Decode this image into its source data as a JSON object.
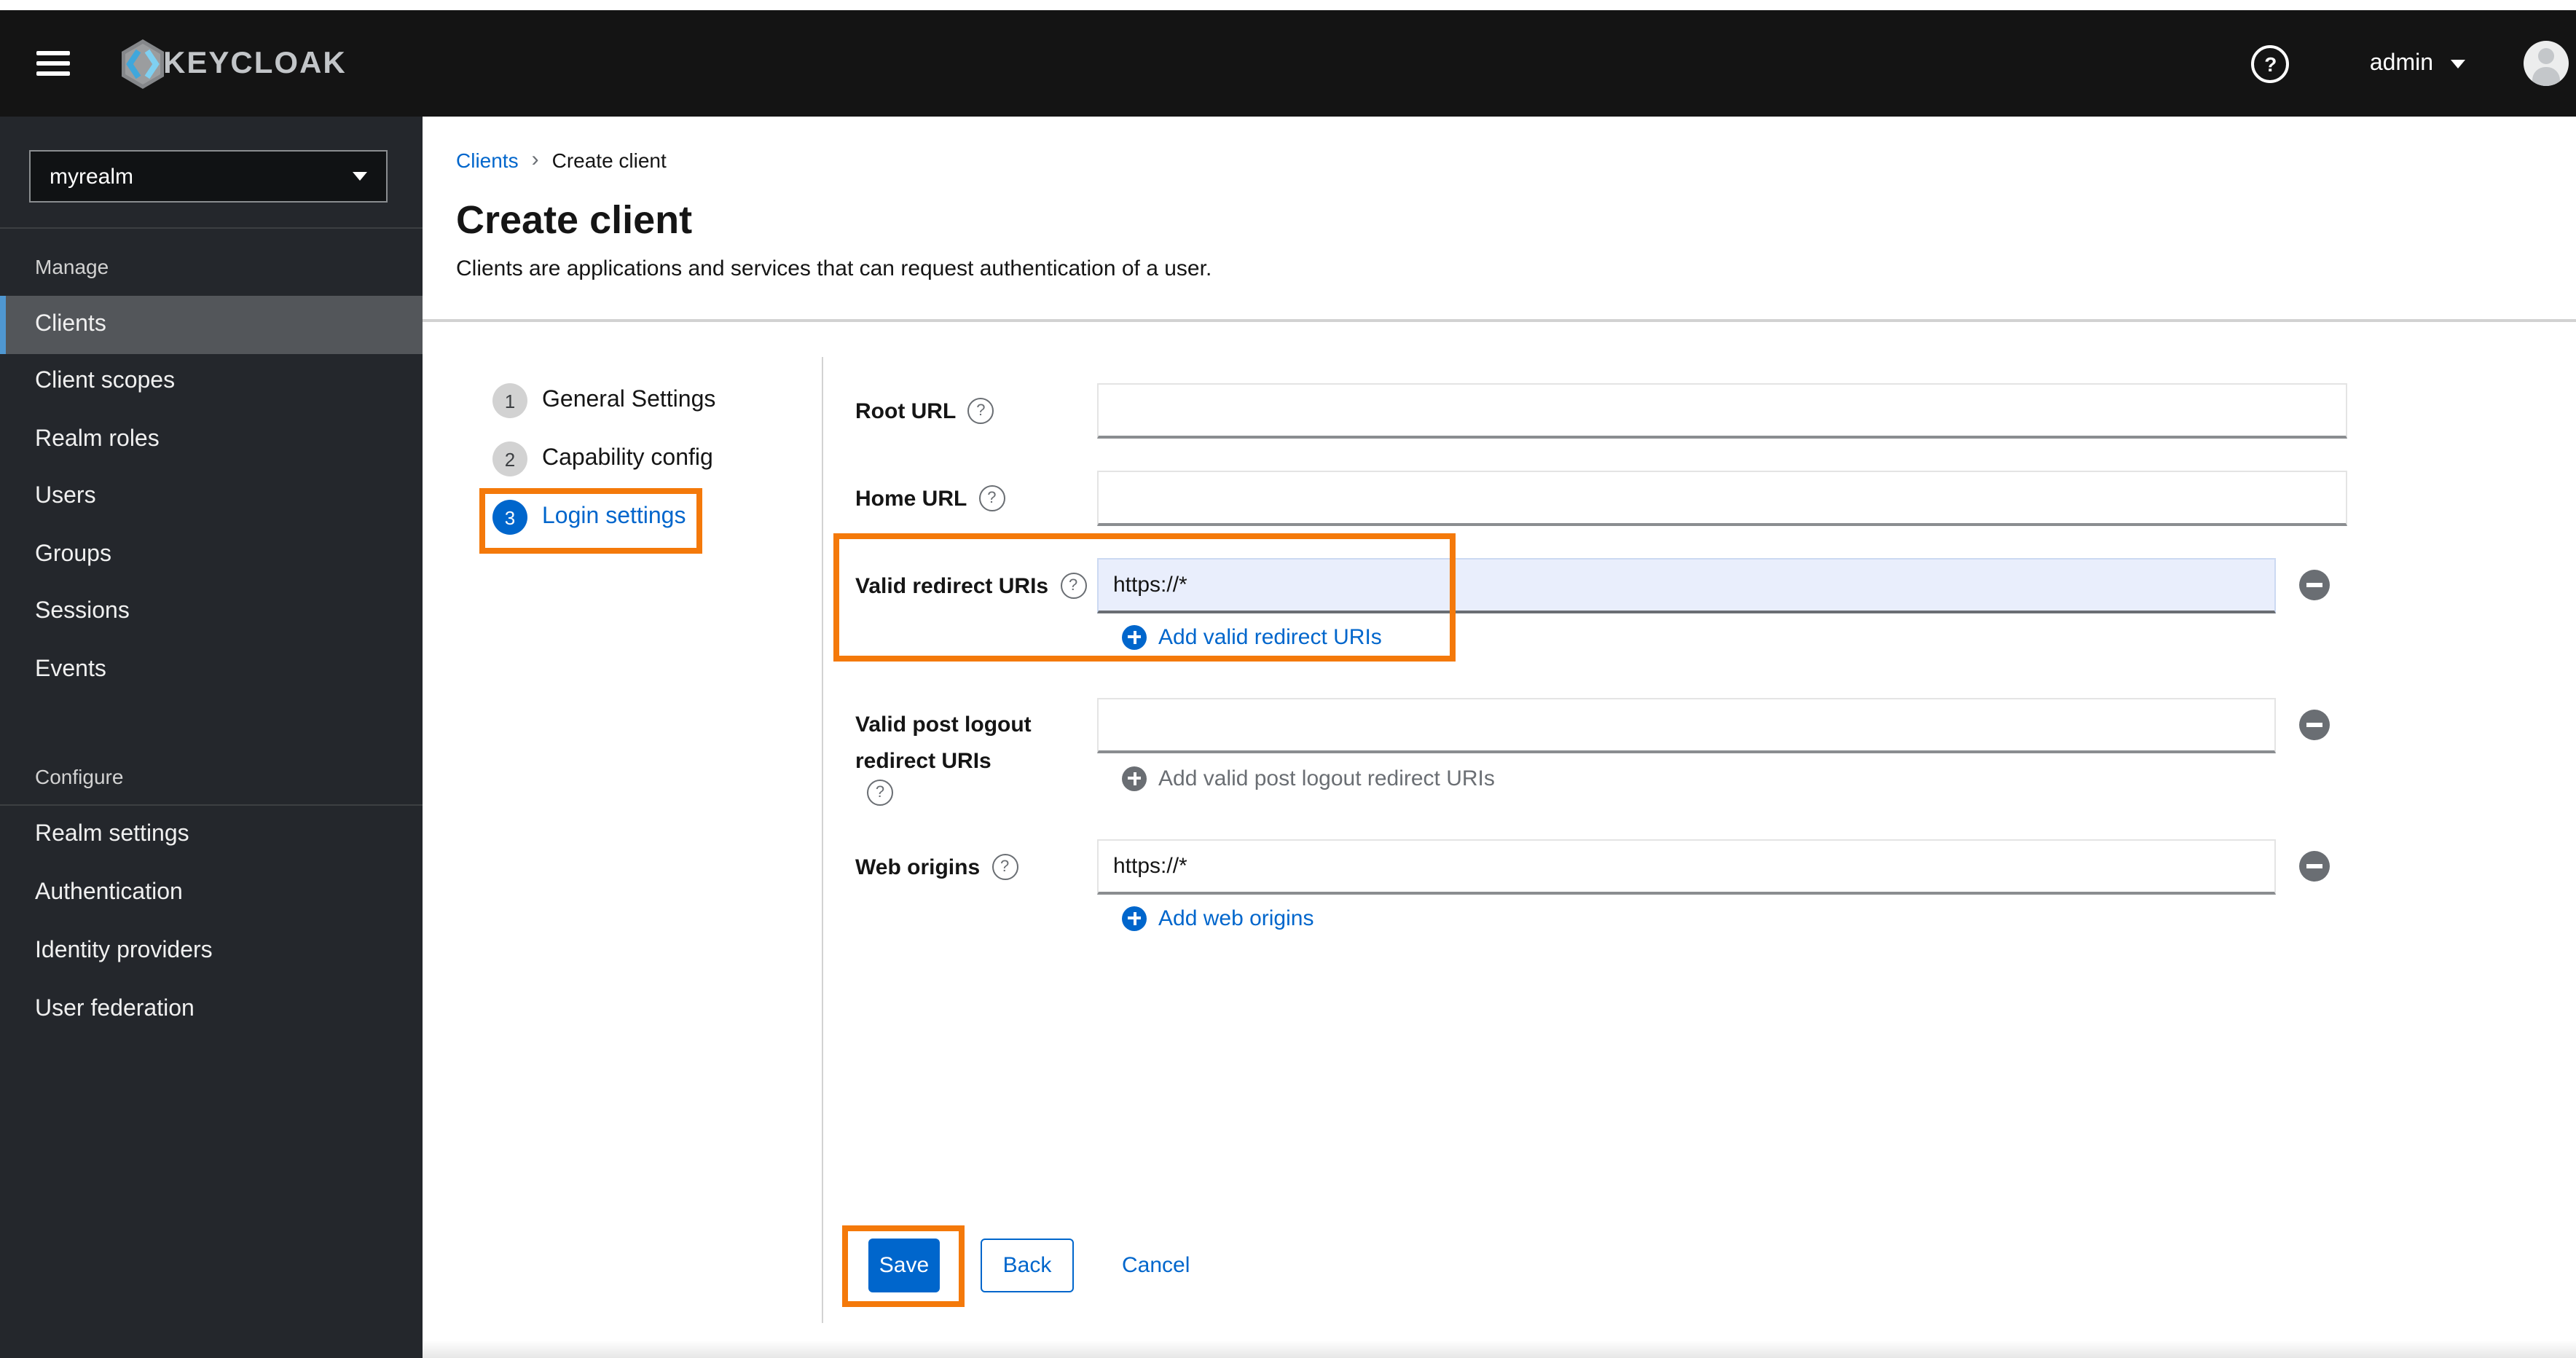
{
  "header": {
    "brand": "KEYCLOAK",
    "username": "admin"
  },
  "sidebar": {
    "realm_selector": {
      "value": "myrealm"
    },
    "sections": [
      {
        "label": "Manage",
        "items": [
          {
            "label": "Clients",
            "selected": true
          },
          {
            "label": "Client scopes"
          },
          {
            "label": "Realm roles"
          },
          {
            "label": "Users"
          },
          {
            "label": "Groups"
          },
          {
            "label": "Sessions"
          },
          {
            "label": "Events"
          }
        ]
      },
      {
        "label": "Configure",
        "items": [
          {
            "label": "Realm settings"
          },
          {
            "label": "Authentication"
          },
          {
            "label": "Identity providers"
          },
          {
            "label": "User federation"
          }
        ]
      }
    ]
  },
  "breadcrumb": {
    "items": [
      {
        "label": "Clients",
        "link": true
      },
      {
        "label": "Create client",
        "current": true
      }
    ]
  },
  "page": {
    "title": "Create client",
    "description": "Clients are applications and services that can request authentication of a user."
  },
  "wizard": {
    "steps": [
      {
        "number": "1",
        "label": "General Settings",
        "active": false
      },
      {
        "number": "2",
        "label": "Capability config",
        "active": false
      },
      {
        "number": "3",
        "label": "Login settings",
        "active": true,
        "annotated": true
      }
    ]
  },
  "form": {
    "fields": [
      {
        "label": "Root URL",
        "value": ""
      },
      {
        "label": "Home URL",
        "value": ""
      },
      {
        "label": "Valid redirect URIs",
        "value": "https://*",
        "focused": true,
        "annotated": true,
        "add_label": "Add valid redirect URIs",
        "removable": true
      },
      {
        "label": "Valid post logout redirect URIs",
        "value": "",
        "add_label": "Add valid post logout redirect URIs",
        "add_disabled": true,
        "removable": true
      },
      {
        "label": "Web origins",
        "value": "https://*",
        "add_label": "Add web origins",
        "removable": true
      }
    ],
    "buttons": {
      "save": "Save",
      "back": "Back",
      "cancel": "Cancel"
    }
  },
  "colors": {
    "accent_blue": "#0066cc",
    "annotation_orange": "#f4790a",
    "header_bg": "#141414",
    "sidebar_bg": "#24272c",
    "nav_selected_bg": "#53565a",
    "nav_selected_stripe": "#4f97d1",
    "focused_input_bg": "#e9eefc",
    "icon_gray": "#6a6e73"
  }
}
